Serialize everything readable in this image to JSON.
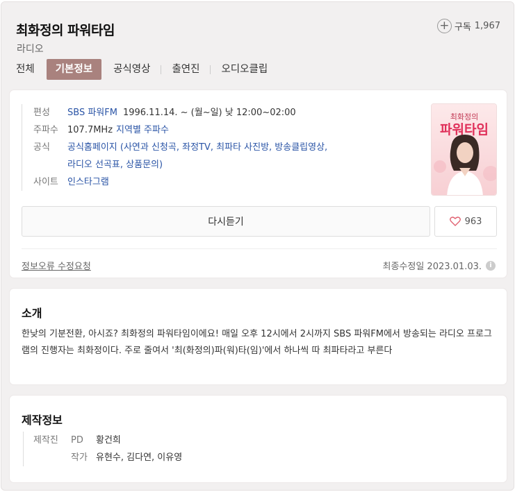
{
  "header": {
    "title": "최화정의 파워타임",
    "subtitle": "라디오",
    "subscribe_label": "구독",
    "subscribe_count": "1,967"
  },
  "tabs": [
    "전체",
    "기본정보",
    "공식영상",
    "출연진",
    "오디오클립"
  ],
  "active_tab": 1,
  "info": {
    "broadcast_label": "편성",
    "broadcast_channel": "SBS 파워FM",
    "broadcast_schedule": "1996.11.14. ~  (월~일) 낮 12:00~02:00",
    "frequency_label": "주파수",
    "frequency_value": "107.7MHz",
    "frequency_link": "지역별 주파수",
    "official_label": "공식",
    "official_line1": "공식홈페이지 (사연과 신청곡, 좌정TV, 최파타 사진방, 방송클립영상,",
    "official_line2": "라디오 선곡표, 상품문의)",
    "site_label": "사이트",
    "site_value": "인스타그램"
  },
  "poster": {
    "title_line1": "최화정의",
    "title_line2": "파워타임"
  },
  "actions": {
    "replay_label": "다시듣기",
    "like_count": "963"
  },
  "footer": {
    "report_label": "정보오류 수정요청",
    "updated_label": "최종수정일 2023.01.03.",
    "info_icon_glyph": "i"
  },
  "intro": {
    "title": "소개",
    "text": "한낮의 기분전환, 아시죠? 최화정의 파워타임이에요! 매일 오후 12시에서 2시까지 SBS 파워FM에서 방송되는 라디오 프로그램의 진행자는 최화정이다. 주로 줄여서 '최(화정의)파(워)타(임)'에서 하나씩 따 최파타라고 부른다"
  },
  "production": {
    "title": "제작정보",
    "staff_label": "제작진",
    "pd_role": "PD",
    "pd_name": "황건희",
    "writer_role": "작가",
    "writer_names": "유현수, 김다연, 이유영"
  },
  "colors": {
    "accent": "#a9827e",
    "link": "#2a54a6",
    "background": "#f2f0f0"
  },
  "icons": [
    "plus-circle-icon",
    "heart-icon",
    "info-icon"
  ]
}
